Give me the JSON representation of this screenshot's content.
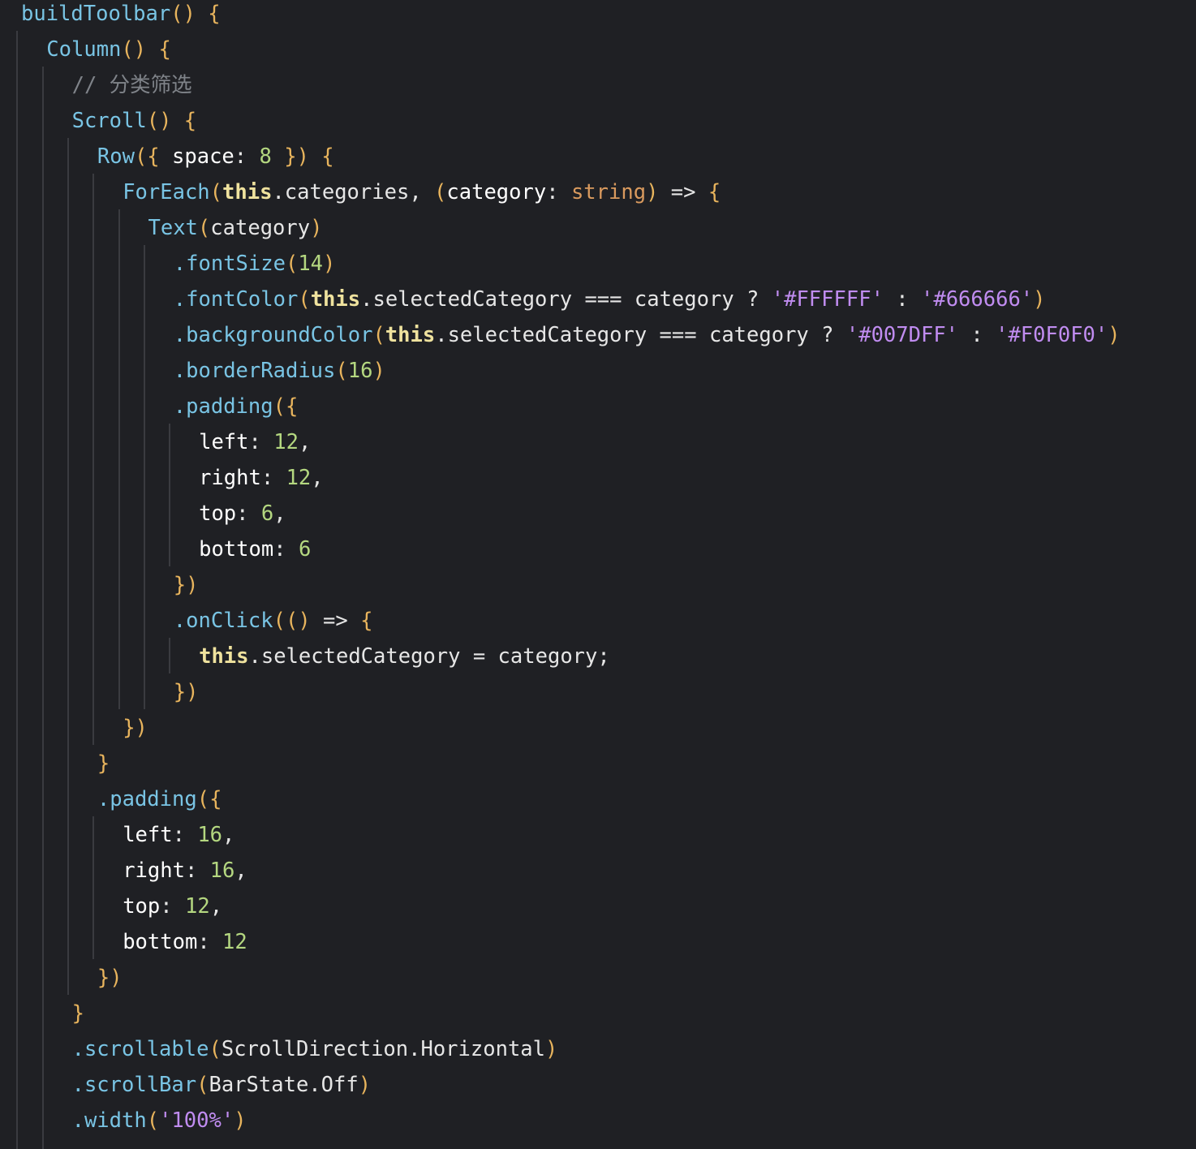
{
  "editor": {
    "lines": [
      {
        "indent": 0,
        "tokens": [
          [
            "fn",
            "buildToolbar"
          ],
          [
            "pun",
            "() {"
          ]
        ]
      },
      {
        "indent": 1,
        "tokens": [
          [
            "fn",
            "Column"
          ],
          [
            "pun",
            "() {"
          ]
        ]
      },
      {
        "indent": 2,
        "tokens": [
          [
            "cmt",
            "// 分类筛选"
          ]
        ]
      },
      {
        "indent": 2,
        "tokens": [
          [
            "fn",
            "Scroll"
          ],
          [
            "pun",
            "() {"
          ]
        ]
      },
      {
        "indent": 3,
        "tokens": [
          [
            "fn",
            "Row"
          ],
          [
            "pun",
            "({ "
          ],
          [
            "prop",
            "space"
          ],
          [
            "op",
            ": "
          ],
          [
            "num",
            "8"
          ],
          [
            "pun",
            " }) {"
          ]
        ]
      },
      {
        "indent": 4,
        "tokens": [
          [
            "fn",
            "ForEach"
          ],
          [
            "pun",
            "("
          ],
          [
            "kw",
            "this"
          ],
          [
            "plain",
            ".categories, "
          ],
          [
            "pun",
            "("
          ],
          [
            "prop",
            "category"
          ],
          [
            "op",
            ": "
          ],
          [
            "type",
            "string"
          ],
          [
            "pun",
            ") "
          ],
          [
            "op",
            "=> "
          ],
          [
            "pun",
            "{"
          ]
        ]
      },
      {
        "indent": 5,
        "tokens": [
          [
            "fn",
            "Text"
          ],
          [
            "pun",
            "("
          ],
          [
            "plain",
            "category"
          ],
          [
            "pun",
            ")"
          ]
        ]
      },
      {
        "indent": 6,
        "tokens": [
          [
            "fn",
            ".fontSize"
          ],
          [
            "pun",
            "("
          ],
          [
            "num",
            "14"
          ],
          [
            "pun",
            ")"
          ]
        ]
      },
      {
        "indent": 6,
        "tokens": [
          [
            "fn",
            ".fontColor"
          ],
          [
            "pun",
            "("
          ],
          [
            "kw",
            "this"
          ],
          [
            "plain",
            ".selectedCategory === category ? "
          ],
          [
            "str",
            "'#FFFFFF'"
          ],
          [
            "plain",
            " : "
          ],
          [
            "str",
            "'#666666'"
          ],
          [
            "pun",
            ")"
          ]
        ]
      },
      {
        "indent": 6,
        "tokens": [
          [
            "fn",
            ".backgroundColor"
          ],
          [
            "pun",
            "("
          ],
          [
            "kw",
            "this"
          ],
          [
            "plain",
            ".selectedCategory === category ? "
          ],
          [
            "str",
            "'#007DFF'"
          ],
          [
            "plain",
            " : "
          ],
          [
            "str",
            "'#F0F0F0'"
          ],
          [
            "pun",
            ")"
          ]
        ]
      },
      {
        "indent": 6,
        "tokens": [
          [
            "fn",
            ".borderRadius"
          ],
          [
            "pun",
            "("
          ],
          [
            "num",
            "16"
          ],
          [
            "pun",
            ")"
          ]
        ]
      },
      {
        "indent": 6,
        "tokens": [
          [
            "fn",
            ".padding"
          ],
          [
            "pun",
            "({"
          ]
        ]
      },
      {
        "indent": 7,
        "tokens": [
          [
            "prop",
            "left"
          ],
          [
            "op",
            ": "
          ],
          [
            "num",
            "12"
          ],
          [
            "plain",
            ","
          ]
        ]
      },
      {
        "indent": 7,
        "tokens": [
          [
            "prop",
            "right"
          ],
          [
            "op",
            ": "
          ],
          [
            "num",
            "12"
          ],
          [
            "plain",
            ","
          ]
        ]
      },
      {
        "indent": 7,
        "tokens": [
          [
            "prop",
            "top"
          ],
          [
            "op",
            ": "
          ],
          [
            "num",
            "6"
          ],
          [
            "plain",
            ","
          ]
        ]
      },
      {
        "indent": 7,
        "tokens": [
          [
            "prop",
            "bottom"
          ],
          [
            "op",
            ": "
          ],
          [
            "num",
            "6"
          ]
        ]
      },
      {
        "indent": 6,
        "tokens": [
          [
            "pun",
            "})"
          ]
        ]
      },
      {
        "indent": 6,
        "tokens": [
          [
            "fn",
            ".onClick"
          ],
          [
            "pun",
            "(() "
          ],
          [
            "op",
            "=> "
          ],
          [
            "pun",
            "{"
          ]
        ]
      },
      {
        "indent": 7,
        "tokens": [
          [
            "kw",
            "this"
          ],
          [
            "plain",
            ".selectedCategory = category;"
          ]
        ]
      },
      {
        "indent": 6,
        "tokens": [
          [
            "pun",
            "})"
          ]
        ]
      },
      {
        "indent": 4,
        "tokens": [
          [
            "pun",
            "})"
          ]
        ]
      },
      {
        "indent": 3,
        "tokens": [
          [
            "pun",
            "}"
          ]
        ]
      },
      {
        "indent": 3,
        "tokens": [
          [
            "fn",
            ".padding"
          ],
          [
            "pun",
            "({"
          ]
        ]
      },
      {
        "indent": 4,
        "tokens": [
          [
            "prop",
            "left"
          ],
          [
            "op",
            ": "
          ],
          [
            "num",
            "16"
          ],
          [
            "plain",
            ","
          ]
        ]
      },
      {
        "indent": 4,
        "tokens": [
          [
            "prop",
            "right"
          ],
          [
            "op",
            ": "
          ],
          [
            "num",
            "16"
          ],
          [
            "plain",
            ","
          ]
        ]
      },
      {
        "indent": 4,
        "tokens": [
          [
            "prop",
            "top"
          ],
          [
            "op",
            ": "
          ],
          [
            "num",
            "12"
          ],
          [
            "plain",
            ","
          ]
        ]
      },
      {
        "indent": 4,
        "tokens": [
          [
            "prop",
            "bottom"
          ],
          [
            "op",
            ": "
          ],
          [
            "num",
            "12"
          ]
        ]
      },
      {
        "indent": 3,
        "tokens": [
          [
            "pun",
            "})"
          ]
        ]
      },
      {
        "indent": 2,
        "tokens": [
          [
            "pun",
            "}"
          ]
        ]
      },
      {
        "indent": 2,
        "tokens": [
          [
            "fn",
            ".scrollable"
          ],
          [
            "pun",
            "("
          ],
          [
            "plain",
            "ScrollDirection.Horizontal"
          ],
          [
            "pun",
            ")"
          ]
        ]
      },
      {
        "indent": 2,
        "tokens": [
          [
            "fn",
            ".scrollBar"
          ],
          [
            "pun",
            "("
          ],
          [
            "plain",
            "BarState.Off"
          ],
          [
            "pun",
            ")"
          ]
        ]
      },
      {
        "indent": 2,
        "tokens": [
          [
            "fn",
            ".width"
          ],
          [
            "pun",
            "("
          ],
          [
            "str",
            "'100%'"
          ],
          [
            "pun",
            ")"
          ]
        ]
      }
    ]
  }
}
